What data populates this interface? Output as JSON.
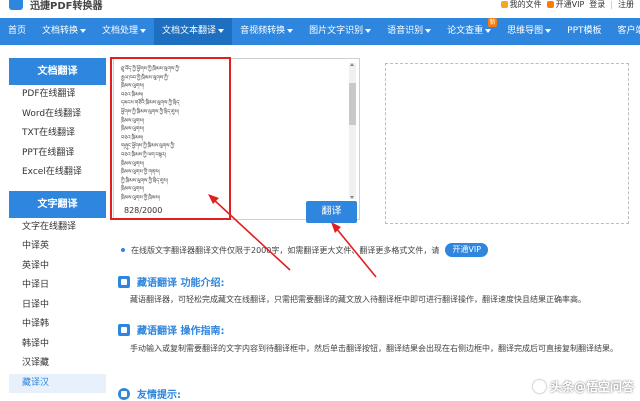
{
  "header": {
    "logo_text": "迅捷PDF转换器",
    "my_files": "我的文件",
    "open_vip": "开通VIP",
    "login": "登录",
    "separator": "|",
    "register": "注册",
    "brand_color": "#2e86de"
  },
  "nav": {
    "items": [
      {
        "label": "首页",
        "has_caret": false
      },
      {
        "label": "文档转换",
        "has_caret": true
      },
      {
        "label": "文档处理",
        "has_caret": true
      },
      {
        "label": "文档文本翻译",
        "has_caret": true
      },
      {
        "label": "音视频转换",
        "has_caret": true
      },
      {
        "label": "图片文字识别",
        "has_caret": true
      },
      {
        "label": "语音识别",
        "has_caret": true
      },
      {
        "label": "论文查重",
        "has_caret": true
      },
      {
        "label": "思维导图",
        "has_caret": true
      },
      {
        "label": "PPT模板",
        "has_caret": false
      },
      {
        "label": "客户端",
        "has_caret": true
      }
    ],
    "active_index": 3,
    "badge_label": "新"
  },
  "sidebar": {
    "doc_title": "文档翻译",
    "doc_items": [
      "PDF在线翻译",
      "Word在线翻译",
      "TXT在线翻译",
      "PPT在线翻译",
      "Excel在线翻译"
    ],
    "text_title": "文字翻译",
    "text_items": [
      "文字在线翻译",
      "中译英",
      "英译中",
      "中译日",
      "日译中",
      "中译韩",
      "韩译中",
      "汉译藏",
      "藏译汉"
    ],
    "active_item": "藏译汉"
  },
  "editor": {
    "lines": [
      "ཐུ་བོད་ཀྱི་ཕྱོགས་ཀྱི་ཁྲིམས་ལུགས་ཀྱི་",
      "རྒྱལ་ཁབ་ཀྱི་ཁྲིམས་ལུགས་ཀྱི་",
      "ཁྲིམས་ལུགས།",
      "བཅའ་ཁྲིམས།",
      "དམངས་གཙོའི་ཁྲིམས་ལུགས་ཀྱི་སྲིད་",
      "ཕྱོགས་ཀྱི་ཁྲིམས་ལུགས་ཀྱི་སྲིད་ཇུས།",
      "ཁྲིམས་ལུགས།",
      "ཁྲིམས་ལུགས།",
      "བཅའ་ཁྲིམས།",
      "གཞུང་ཕྱོགས་ཀྱི་ཁྲིམས་ལུགས་ཀྱི་",
      "བཅའ་ཁྲིམས་ཀྱི་ལག་བསྟར།",
      "ཁྲིམས་ལུགས།",
      "ཁྲིམས་ལུགས་ཀྱི་གནས།",
      "ཀྱི་ཁྲིམས་ལུགས་ཀྱི་སྲིད་ཇུས།",
      "ཁྲིམས་ལུགས།",
      "ཁྲིམས་ལུགས་ཀྱི་ཁྲིམས།"
    ],
    "char_count": "828/2000"
  },
  "translate_button": "翻译",
  "notice": {
    "text": "在线版文字翻译器翻译文件仅限于2000字，如需翻译更大文件、翻译更多格式文件，请",
    "vip_button": "开通VIP"
  },
  "sections": {
    "intro_title": "藏语翻译 功能介绍:",
    "intro_body": "藏语翻译器，可轻松完成藏文在线翻译，只需把需要翻译的藏文放入待翻译框中即可进行翻译操作，翻译速度快且结果正确率高。",
    "guide_title": "藏语翻译 操作指南:",
    "guide_body": "手动输入或复制需要翻译的文字内容到待翻译框中，然后单击翻译按钮，翻译结果会出现在右侧边框中，翻译完成后可直接复制翻译结果。",
    "tips_title": "友情提示:"
  },
  "watermark": "头条@悟空问答",
  "colors": {
    "accent": "#2e86de",
    "highlight_red": "#e02020",
    "vip_orange": "#ff7a00"
  }
}
